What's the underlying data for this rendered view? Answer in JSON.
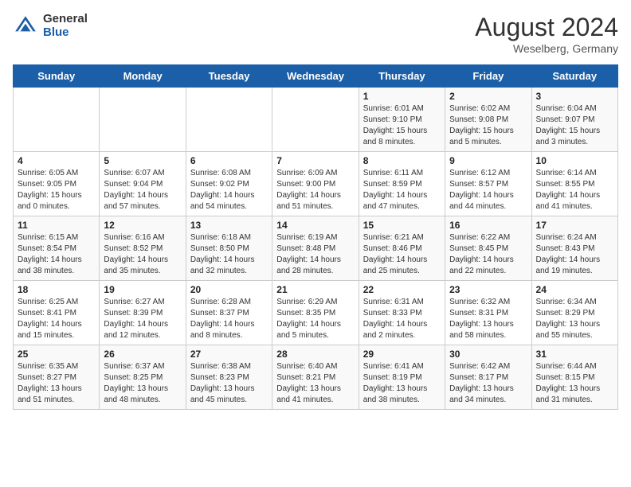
{
  "header": {
    "logo_general": "General",
    "logo_blue": "Blue",
    "month_year": "August 2024",
    "location": "Weselberg, Germany"
  },
  "days_of_week": [
    "Sunday",
    "Monday",
    "Tuesday",
    "Wednesday",
    "Thursday",
    "Friday",
    "Saturday"
  ],
  "weeks": [
    [
      {
        "day": "",
        "info": ""
      },
      {
        "day": "",
        "info": ""
      },
      {
        "day": "",
        "info": ""
      },
      {
        "day": "",
        "info": ""
      },
      {
        "day": "1",
        "info": "Sunrise: 6:01 AM\nSunset: 9:10 PM\nDaylight: 15 hours and 8 minutes."
      },
      {
        "day": "2",
        "info": "Sunrise: 6:02 AM\nSunset: 9:08 PM\nDaylight: 15 hours and 5 minutes."
      },
      {
        "day": "3",
        "info": "Sunrise: 6:04 AM\nSunset: 9:07 PM\nDaylight: 15 hours and 3 minutes."
      }
    ],
    [
      {
        "day": "4",
        "info": "Sunrise: 6:05 AM\nSunset: 9:05 PM\nDaylight: 15 hours and 0 minutes."
      },
      {
        "day": "5",
        "info": "Sunrise: 6:07 AM\nSunset: 9:04 PM\nDaylight: 14 hours and 57 minutes."
      },
      {
        "day": "6",
        "info": "Sunrise: 6:08 AM\nSunset: 9:02 PM\nDaylight: 14 hours and 54 minutes."
      },
      {
        "day": "7",
        "info": "Sunrise: 6:09 AM\nSunset: 9:00 PM\nDaylight: 14 hours and 51 minutes."
      },
      {
        "day": "8",
        "info": "Sunrise: 6:11 AM\nSunset: 8:59 PM\nDaylight: 14 hours and 47 minutes."
      },
      {
        "day": "9",
        "info": "Sunrise: 6:12 AM\nSunset: 8:57 PM\nDaylight: 14 hours and 44 minutes."
      },
      {
        "day": "10",
        "info": "Sunrise: 6:14 AM\nSunset: 8:55 PM\nDaylight: 14 hours and 41 minutes."
      }
    ],
    [
      {
        "day": "11",
        "info": "Sunrise: 6:15 AM\nSunset: 8:54 PM\nDaylight: 14 hours and 38 minutes."
      },
      {
        "day": "12",
        "info": "Sunrise: 6:16 AM\nSunset: 8:52 PM\nDaylight: 14 hours and 35 minutes."
      },
      {
        "day": "13",
        "info": "Sunrise: 6:18 AM\nSunset: 8:50 PM\nDaylight: 14 hours and 32 minutes."
      },
      {
        "day": "14",
        "info": "Sunrise: 6:19 AM\nSunset: 8:48 PM\nDaylight: 14 hours and 28 minutes."
      },
      {
        "day": "15",
        "info": "Sunrise: 6:21 AM\nSunset: 8:46 PM\nDaylight: 14 hours and 25 minutes."
      },
      {
        "day": "16",
        "info": "Sunrise: 6:22 AM\nSunset: 8:45 PM\nDaylight: 14 hours and 22 minutes."
      },
      {
        "day": "17",
        "info": "Sunrise: 6:24 AM\nSunset: 8:43 PM\nDaylight: 14 hours and 19 minutes."
      }
    ],
    [
      {
        "day": "18",
        "info": "Sunrise: 6:25 AM\nSunset: 8:41 PM\nDaylight: 14 hours and 15 minutes."
      },
      {
        "day": "19",
        "info": "Sunrise: 6:27 AM\nSunset: 8:39 PM\nDaylight: 14 hours and 12 minutes."
      },
      {
        "day": "20",
        "info": "Sunrise: 6:28 AM\nSunset: 8:37 PM\nDaylight: 14 hours and 8 minutes."
      },
      {
        "day": "21",
        "info": "Sunrise: 6:29 AM\nSunset: 8:35 PM\nDaylight: 14 hours and 5 minutes."
      },
      {
        "day": "22",
        "info": "Sunrise: 6:31 AM\nSunset: 8:33 PM\nDaylight: 14 hours and 2 minutes."
      },
      {
        "day": "23",
        "info": "Sunrise: 6:32 AM\nSunset: 8:31 PM\nDaylight: 13 hours and 58 minutes."
      },
      {
        "day": "24",
        "info": "Sunrise: 6:34 AM\nSunset: 8:29 PM\nDaylight: 13 hours and 55 minutes."
      }
    ],
    [
      {
        "day": "25",
        "info": "Sunrise: 6:35 AM\nSunset: 8:27 PM\nDaylight: 13 hours and 51 minutes."
      },
      {
        "day": "26",
        "info": "Sunrise: 6:37 AM\nSunset: 8:25 PM\nDaylight: 13 hours and 48 minutes."
      },
      {
        "day": "27",
        "info": "Sunrise: 6:38 AM\nSunset: 8:23 PM\nDaylight: 13 hours and 45 minutes."
      },
      {
        "day": "28",
        "info": "Sunrise: 6:40 AM\nSunset: 8:21 PM\nDaylight: 13 hours and 41 minutes."
      },
      {
        "day": "29",
        "info": "Sunrise: 6:41 AM\nSunset: 8:19 PM\nDaylight: 13 hours and 38 minutes."
      },
      {
        "day": "30",
        "info": "Sunrise: 6:42 AM\nSunset: 8:17 PM\nDaylight: 13 hours and 34 minutes."
      },
      {
        "day": "31",
        "info": "Sunrise: 6:44 AM\nSunset: 8:15 PM\nDaylight: 13 hours and 31 minutes."
      }
    ]
  ]
}
